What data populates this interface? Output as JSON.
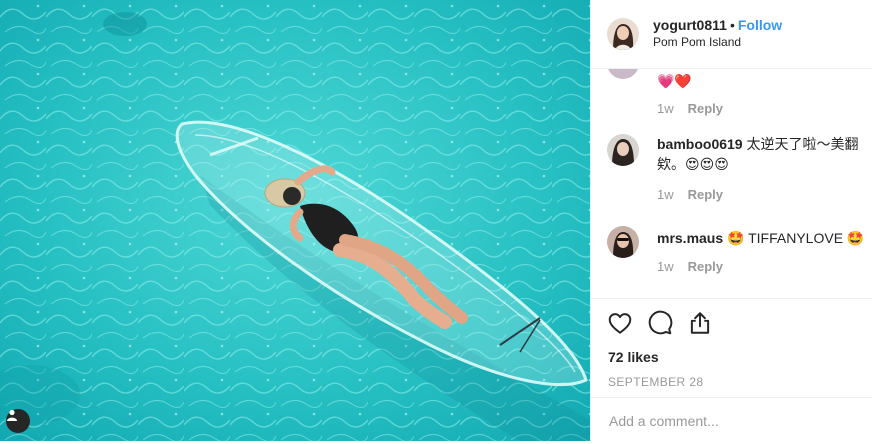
{
  "post": {
    "username": "yogurt0811",
    "separator": "•",
    "follow_label": "Follow",
    "location": "Pom Pom Island"
  },
  "comments": [
    {
      "username": "",
      "text": "💗❤️",
      "time": "1w",
      "reply_label": "Reply"
    },
    {
      "username": "bamboo0619",
      "text": "太逆天了啦～美翻欸。😍😍😍",
      "time": "1w",
      "reply_label": "Reply"
    },
    {
      "username": "mrs.maus",
      "text": "🤩 TIFFANYLOVE 🤩",
      "time": "1w",
      "reply_label": "Reply"
    }
  ],
  "stats": {
    "likes": "72 likes",
    "date": "SEPTEMBER 28"
  },
  "composer": {
    "placeholder": "Add a comment..."
  },
  "icons": [
    "heart-icon",
    "comment-icon",
    "share-icon",
    "user-tag-icon"
  ],
  "colors": {
    "water": "#2bc4c6",
    "link": "#3897f0",
    "muted": "#999999",
    "text": "#262626"
  }
}
